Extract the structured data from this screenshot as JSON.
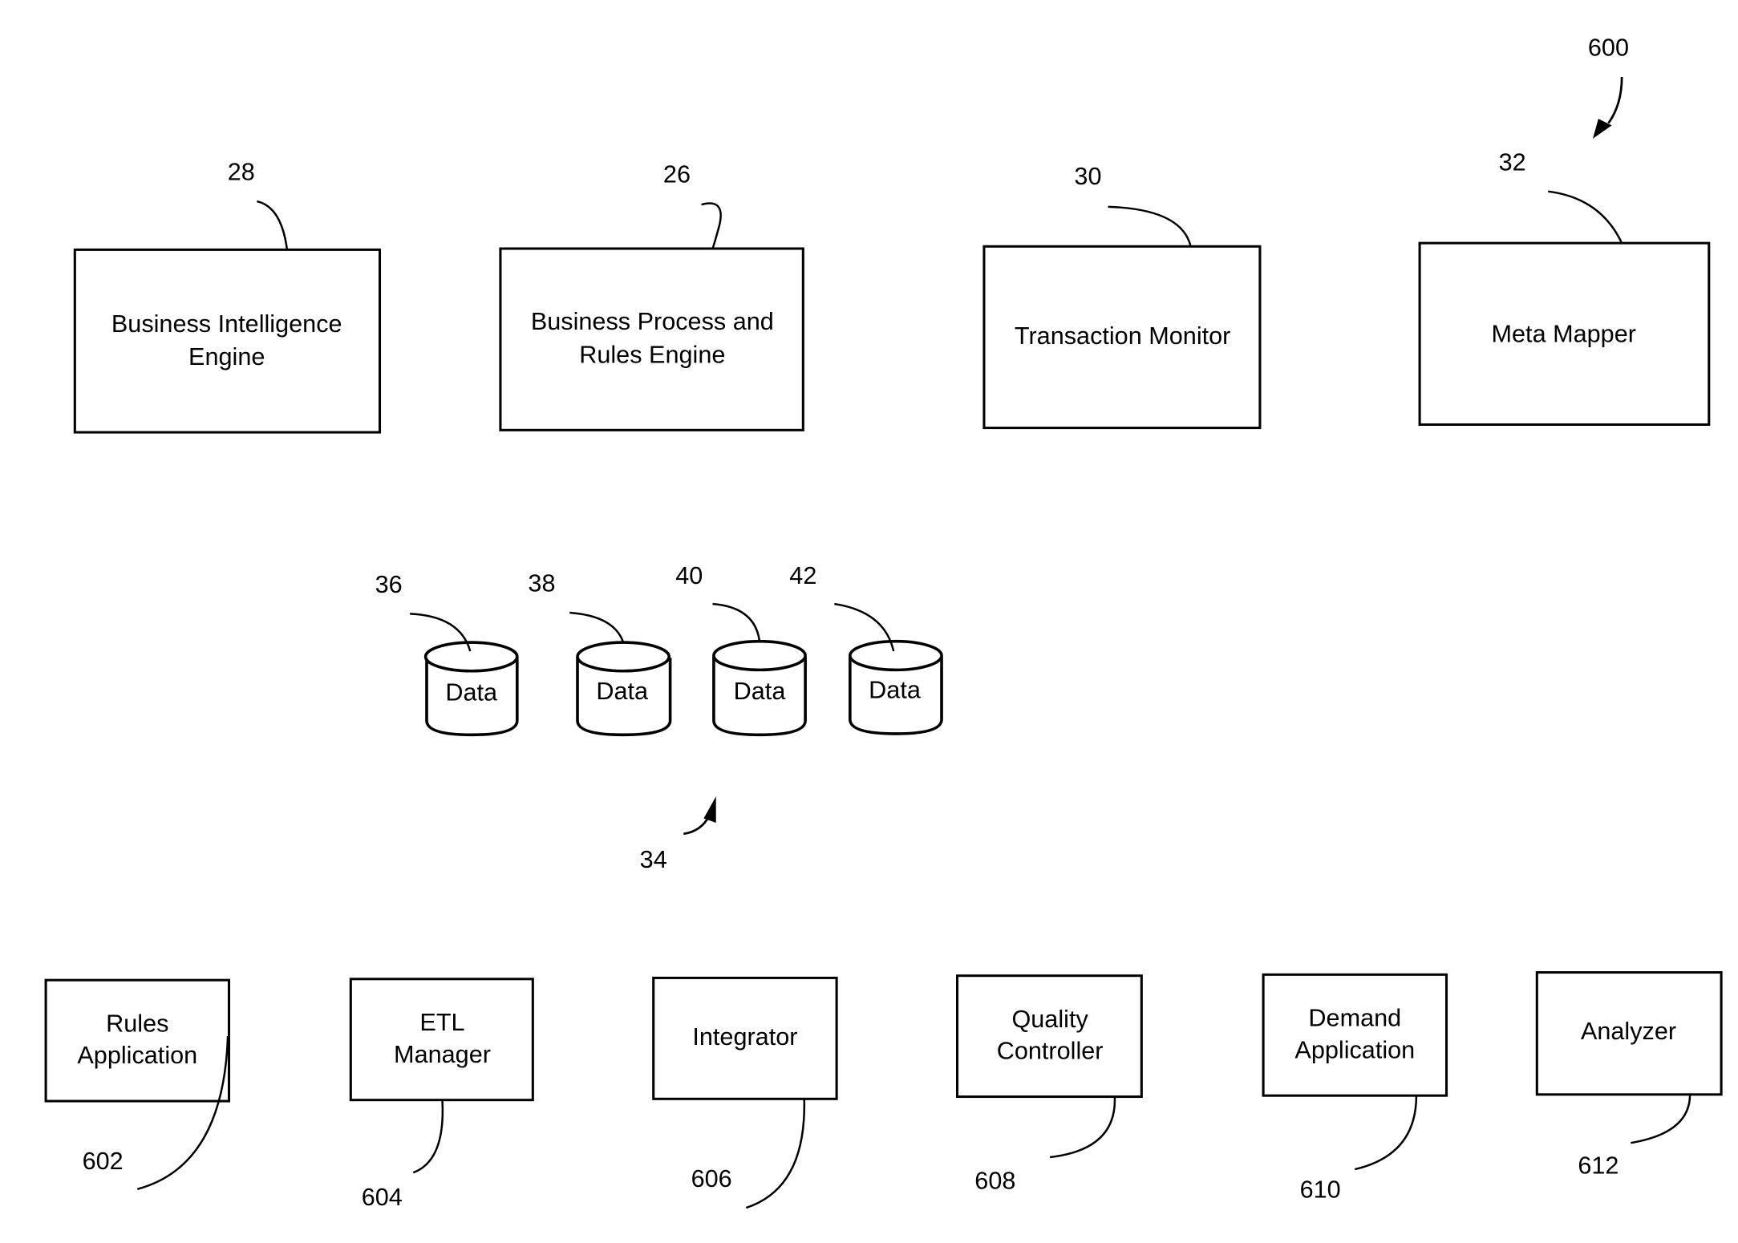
{
  "figure": {
    "reference": "600",
    "description": "System component block diagram"
  },
  "top_components": [
    {
      "ref": "28",
      "lines": [
        "Business Intelligence",
        "Engine"
      ]
    },
    {
      "ref": "26",
      "lines": [
        "Business Process and",
        "Rules Engine"
      ]
    },
    {
      "ref": "30",
      "lines": [
        "Transaction Monitor"
      ]
    },
    {
      "ref": "32",
      "lines": [
        "Meta Mapper"
      ]
    }
  ],
  "data_store_group": {
    "ref": "34",
    "stores": [
      {
        "ref": "36",
        "label": "Data"
      },
      {
        "ref": "38",
        "label": "Data"
      },
      {
        "ref": "40",
        "label": "Data"
      },
      {
        "ref": "42",
        "label": "Data"
      }
    ]
  },
  "bottom_components": [
    {
      "ref": "602",
      "lines": [
        "Rules",
        "Application"
      ]
    },
    {
      "ref": "604",
      "lines": [
        "ETL",
        "Manager"
      ]
    },
    {
      "ref": "606",
      "lines": [
        "Integrator"
      ]
    },
    {
      "ref": "608",
      "lines": [
        "Quality",
        "Controller"
      ]
    },
    {
      "ref": "610",
      "lines": [
        "Demand",
        "Application"
      ]
    },
    {
      "ref": "612",
      "lines": [
        "Analyzer"
      ]
    }
  ]
}
